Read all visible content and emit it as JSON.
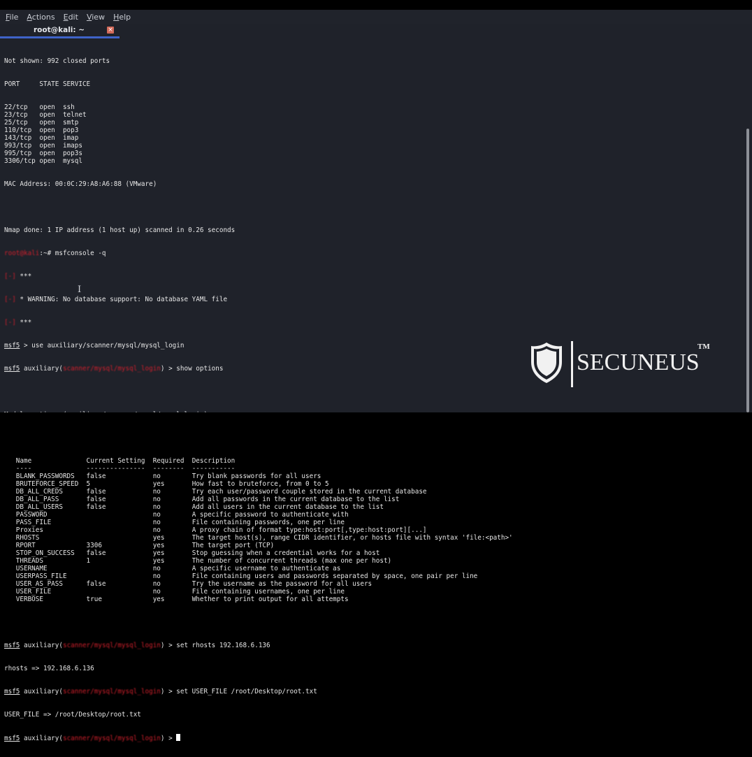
{
  "menubar": {
    "items": [
      {
        "label": "File",
        "accel": "F",
        "rest": "ile"
      },
      {
        "label": "Actions",
        "accel": "A",
        "rest": "ctions"
      },
      {
        "label": "Edit",
        "accel": "E",
        "rest": "dit"
      },
      {
        "label": "View",
        "accel": "V",
        "rest": "iew"
      },
      {
        "label": "Help",
        "accel": "H",
        "rest": "elp"
      }
    ]
  },
  "tab": {
    "title": "root@kali: ~",
    "close_icon": "×"
  },
  "terminal": {
    "nmap": {
      "not_shown": "Not shown: 992 closed ports",
      "header": "PORT     STATE SERVICE",
      "ports": [
        "22/tcp   open  ssh",
        "23/tcp   open  telnet",
        "25/tcp   open  smtp",
        "110/tcp  open  pop3",
        "143/tcp  open  imap",
        "993/tcp  open  imaps",
        "995/tcp  open  pop3s",
        "3306/tcp open  mysql"
      ],
      "mac": "MAC Address: 00:0C:29:A8:A6:88 (VMware)",
      "done": "Nmap done: 1 IP address (1 host up) scanned in 0.26 seconds"
    },
    "shell_prompt_user": "root@kali",
    "shell_prompt_rest": ":~# ",
    "shell_command": "msfconsole -q",
    "warn_marker": "[-]",
    "warn_lines": [
      " ***",
      " * WARNING: No database support: No database YAML file",
      " ***"
    ],
    "msf_label": "msf5",
    "use_cmd": " > use auxiliary/scanner/mysql/mysql_login",
    "aux_prefix": " auxiliary(",
    "module_path": "scanner/mysql/mysql_login",
    "aux_suffix": ") > ",
    "show_cmd": "show options",
    "module_options_title": "Module options (auxiliary/scanner/mysql/mysql_login):",
    "options_table": {
      "headers": [
        "Name",
        "Current Setting",
        "Required",
        "Description"
      ],
      "underline": [
        "----",
        "---------------",
        "--------",
        "-----------"
      ],
      "rows": [
        [
          "BLANK_PASSWORDS",
          "false",
          "no",
          "Try blank passwords for all users"
        ],
        [
          "BRUTEFORCE_SPEED",
          "5",
          "yes",
          "How fast to bruteforce, from 0 to 5"
        ],
        [
          "DB_ALL_CREDS",
          "false",
          "no",
          "Try each user/password couple stored in the current database"
        ],
        [
          "DB_ALL_PASS",
          "false",
          "no",
          "Add all passwords in the current database to the list"
        ],
        [
          "DB_ALL_USERS",
          "false",
          "no",
          "Add all users in the current database to the list"
        ],
        [
          "PASSWORD",
          "",
          "no",
          "A specific password to authenticate with"
        ],
        [
          "PASS_FILE",
          "",
          "no",
          "File containing passwords, one per line"
        ],
        [
          "Proxies",
          "",
          "no",
          "A proxy chain of format type:host:port[,type:host:port][...]"
        ],
        [
          "RHOSTS",
          "",
          "yes",
          "The target host(s), range CIDR identifier, or hosts file with syntax 'file:<path>'"
        ],
        [
          "RPORT",
          "3306",
          "yes",
          "The target port (TCP)"
        ],
        [
          "STOP_ON_SUCCESS",
          "false",
          "yes",
          "Stop guessing when a credential works for a host"
        ],
        [
          "THREADS",
          "1",
          "yes",
          "The number of concurrent threads (max one per host)"
        ],
        [
          "USERNAME",
          "",
          "no",
          "A specific username to authenticate as"
        ],
        [
          "USERPASS_FILE",
          "",
          "no",
          "File containing users and passwords separated by space, one pair per line"
        ],
        [
          "USER_AS_PASS",
          "false",
          "no",
          "Try the username as the password for all users"
        ],
        [
          "USER_FILE",
          "",
          "no",
          "File containing usernames, one per line"
        ],
        [
          "VERBOSE",
          "true",
          "yes",
          "Whether to print output for all attempts"
        ]
      ]
    },
    "set_rhosts_cmd": "set rhosts 192.168.6.136",
    "rhosts_result": "rhosts => 192.168.6.136",
    "set_userfile_cmd": "set USER_FILE /root/Desktop/root.txt",
    "userfile_result": "USER_FILE => /root/Desktop/root.txt"
  },
  "watermark": {
    "brand": "SECUNEUS",
    "tm": "TM",
    "icon": "shield-icon"
  },
  "colors": {
    "background": "#1f222a",
    "prompt_red": "#c61f2a",
    "tab_accent": "#3f63c8",
    "text": "#e6e6e6"
  }
}
